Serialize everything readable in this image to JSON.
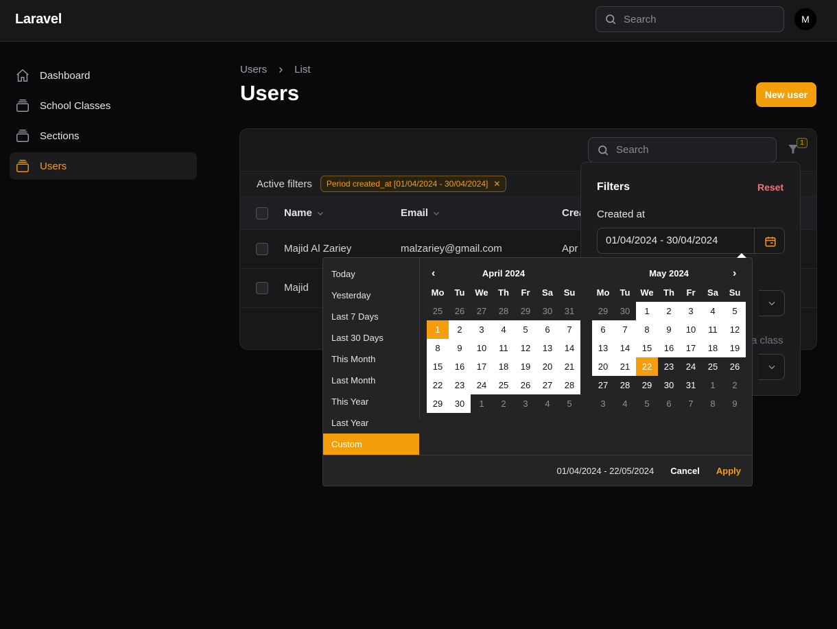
{
  "app": {
    "brand": "Laravel",
    "avatar_initial": "M",
    "accent": "#f59e0b"
  },
  "topbar": {
    "search_placeholder": "Search"
  },
  "sidebar": {
    "items": [
      {
        "label": "Dashboard",
        "icon": "home-icon"
      },
      {
        "label": "School Classes",
        "icon": "stack-icon"
      },
      {
        "label": "Sections",
        "icon": "stack-icon"
      },
      {
        "label": "Users",
        "icon": "stack-icon",
        "active": true
      }
    ]
  },
  "breadcrumb": {
    "parent": "Users",
    "current": "List"
  },
  "page": {
    "title": "Users",
    "new_button": "New user"
  },
  "table": {
    "search_placeholder": "Search",
    "filter_count": "1",
    "active_filters_label": "Active filters",
    "filter_chip": "Period created_at [01/04/2024 - 30/04/2024]",
    "columns": {
      "name": "Name",
      "email": "Email",
      "created": "Crea"
    },
    "rows": [
      {
        "name": "Majid Al Zariey",
        "email": "malzariey@gmail.com",
        "created": "Apr"
      },
      {
        "name": "Majid",
        "email": "",
        "created": ""
      }
    ]
  },
  "filters": {
    "title": "Filters",
    "reset": "Reset",
    "created_label": "Created at",
    "created_value": "01/04/2024 - 30/04/2024",
    "class_label_partial": "a class"
  },
  "picker": {
    "ranges": [
      "Today",
      "Yesterday",
      "Last 7 Days",
      "Last 30 Days",
      "This Month",
      "Last Month",
      "This Year",
      "Last Year",
      "Custom"
    ],
    "active_range": "Custom",
    "weekdays": [
      "Mo",
      "Tu",
      "We",
      "Th",
      "Fr",
      "Sa",
      "Su"
    ],
    "left_month": {
      "title": "April 2024",
      "days": [
        [
          "25",
          "off"
        ],
        [
          "26",
          "off"
        ],
        [
          "27",
          "off"
        ],
        [
          "28",
          "off"
        ],
        [
          "29",
          "off"
        ],
        [
          "30",
          "off"
        ],
        [
          "31",
          "off"
        ],
        [
          "1",
          "sel"
        ],
        [
          "2",
          "in"
        ],
        [
          "3",
          "in"
        ],
        [
          "4",
          "in"
        ],
        [
          "5",
          "in"
        ],
        [
          "6",
          "in"
        ],
        [
          "7",
          "in"
        ],
        [
          "8",
          "in"
        ],
        [
          "9",
          "in"
        ],
        [
          "10",
          "in"
        ],
        [
          "11",
          "in"
        ],
        [
          "12",
          "in"
        ],
        [
          "13",
          "in"
        ],
        [
          "14",
          "in"
        ],
        [
          "15",
          "in"
        ],
        [
          "16",
          "in"
        ],
        [
          "17",
          "in"
        ],
        [
          "18",
          "in"
        ],
        [
          "19",
          "in"
        ],
        [
          "20",
          "in"
        ],
        [
          "21",
          "in"
        ],
        [
          "22",
          "in"
        ],
        [
          "23",
          "in"
        ],
        [
          "24",
          "in"
        ],
        [
          "25",
          "in"
        ],
        [
          "26",
          "in"
        ],
        [
          "27",
          "in"
        ],
        [
          "28",
          "in"
        ],
        [
          "29",
          "in"
        ],
        [
          "30",
          "in"
        ],
        [
          "1",
          "off"
        ],
        [
          "2",
          "off"
        ],
        [
          "3",
          "off"
        ],
        [
          "4",
          "off"
        ],
        [
          "5",
          "off"
        ]
      ]
    },
    "right_month": {
      "title": "May 2024",
      "days": [
        [
          "29",
          "off"
        ],
        [
          "30",
          "off"
        ],
        [
          "1",
          "in"
        ],
        [
          "2",
          "in"
        ],
        [
          "3",
          "in"
        ],
        [
          "4",
          "in"
        ],
        [
          "5",
          "in"
        ],
        [
          "6",
          "in"
        ],
        [
          "7",
          "in"
        ],
        [
          "8",
          "in"
        ],
        [
          "9",
          "in"
        ],
        [
          "10",
          "in"
        ],
        [
          "11",
          "in"
        ],
        [
          "12",
          "in"
        ],
        [
          "13",
          "in"
        ],
        [
          "14",
          "in"
        ],
        [
          "15",
          "in"
        ],
        [
          "16",
          "in"
        ],
        [
          "17",
          "in"
        ],
        [
          "18",
          "in"
        ],
        [
          "19",
          "in"
        ],
        [
          "20",
          "in"
        ],
        [
          "21",
          "in"
        ],
        [
          "22",
          "sel"
        ],
        [
          "23",
          ""
        ],
        [
          "24",
          ""
        ],
        [
          "25",
          ""
        ],
        [
          "26",
          ""
        ],
        [
          "27",
          ""
        ],
        [
          "28",
          ""
        ],
        [
          "29",
          ""
        ],
        [
          "30",
          ""
        ],
        [
          "31",
          ""
        ],
        [
          "1",
          "off"
        ],
        [
          "2",
          "off"
        ],
        [
          "3",
          "off"
        ],
        [
          "4",
          "off"
        ],
        [
          "5",
          "off"
        ],
        [
          "6",
          "off"
        ],
        [
          "7",
          "off"
        ],
        [
          "8",
          "off"
        ],
        [
          "9",
          "off"
        ]
      ]
    },
    "selected_range": "01/04/2024 - 22/05/2024",
    "cancel": "Cancel",
    "apply": "Apply"
  }
}
